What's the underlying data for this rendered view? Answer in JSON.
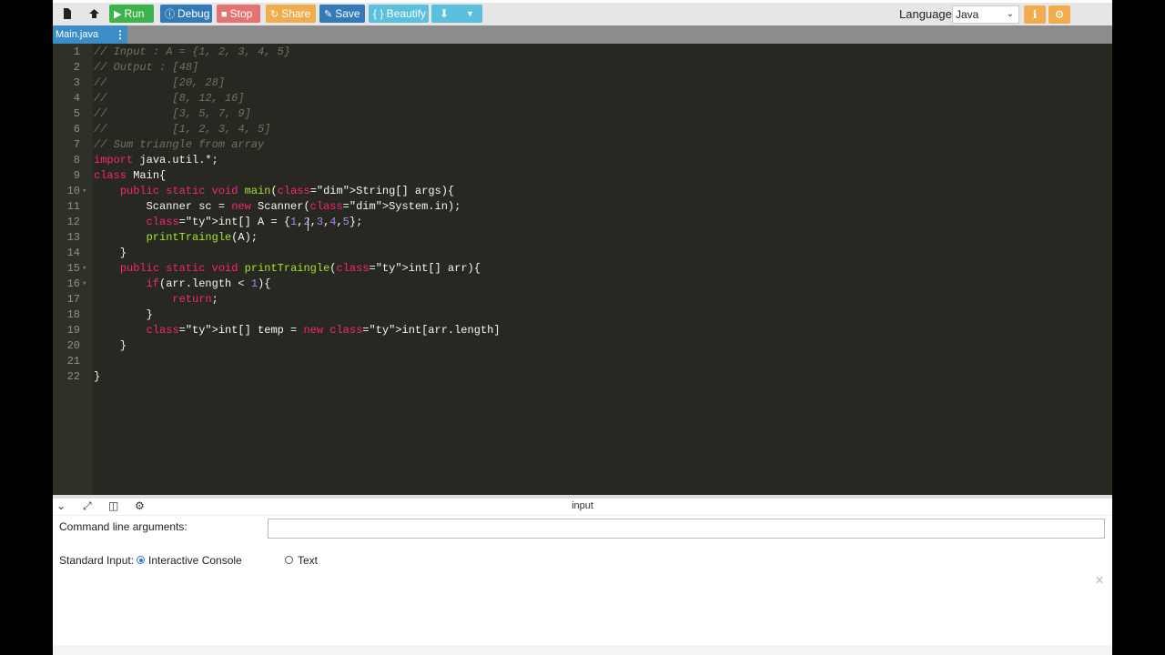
{
  "toolbar": {
    "run": "Run",
    "debug": "Debug",
    "stop": "Stop",
    "share": "Share",
    "save": "Save",
    "beautify": "{ } Beautify",
    "language_label": "Language",
    "language_value": "Java"
  },
  "colors": {
    "run": "#3cb44b",
    "debug": "#337ab7",
    "stop": "#e57373",
    "share": "#f0ad4e",
    "save": "#337ab7",
    "beautify": "#5bc0de",
    "download": "#5bc0de"
  },
  "icons": [
    "file-icon",
    "upload-icon",
    "play-icon",
    "debug-icon",
    "stop-icon",
    "share-icon",
    "save-icon",
    "download-icon",
    "dropdown-icon",
    "info-icon",
    "settings-icon",
    "collapse-icon",
    "expand-icon",
    "layout-icon",
    "gear-icon",
    "close-icon"
  ],
  "tab": {
    "file_name": "Main.java",
    "menu": "⋮"
  },
  "editor": {
    "line_numbers": [
      "1",
      "2",
      "3",
      "4",
      "5",
      "6",
      "7",
      "8",
      "9",
      "10",
      "11",
      "12",
      "13",
      "14",
      "15",
      "16",
      "17",
      "18",
      "19",
      "20",
      "21",
      "22"
    ],
    "lines": [
      "// Input : A = {1, 2, 3, 4, 5}",
      "// Output : [48]",
      "//          [20, 28]",
      "//          [8, 12, 16]",
      "//          [3, 5, 7, 9]",
      "//          [1, 2, 3, 4, 5]",
      "// Sum triangle from array",
      "import java.util.*;",
      "class Main{",
      "    public static void main(String[] args){",
      "        Scanner sc = new Scanner(System.in);",
      "        int[] A = {1,2,3,4,5};",
      "        printTraingle(A);",
      "    }",
      "    public static void printTraingle(int[] arr){",
      "        if(arr.length < 1){",
      "            return;",
      "        }",
      "        int[] temp = new int[arr.length]",
      "    }",
      "",
      "}"
    ]
  },
  "input_panel": {
    "title": "input",
    "command_line_label": "Command line arguments:",
    "command_line_value": "",
    "standard_input_label": "Standard Input:",
    "option_interactive": "Interactive Console",
    "option_text": "Text",
    "selected_option": "Interactive Console"
  }
}
